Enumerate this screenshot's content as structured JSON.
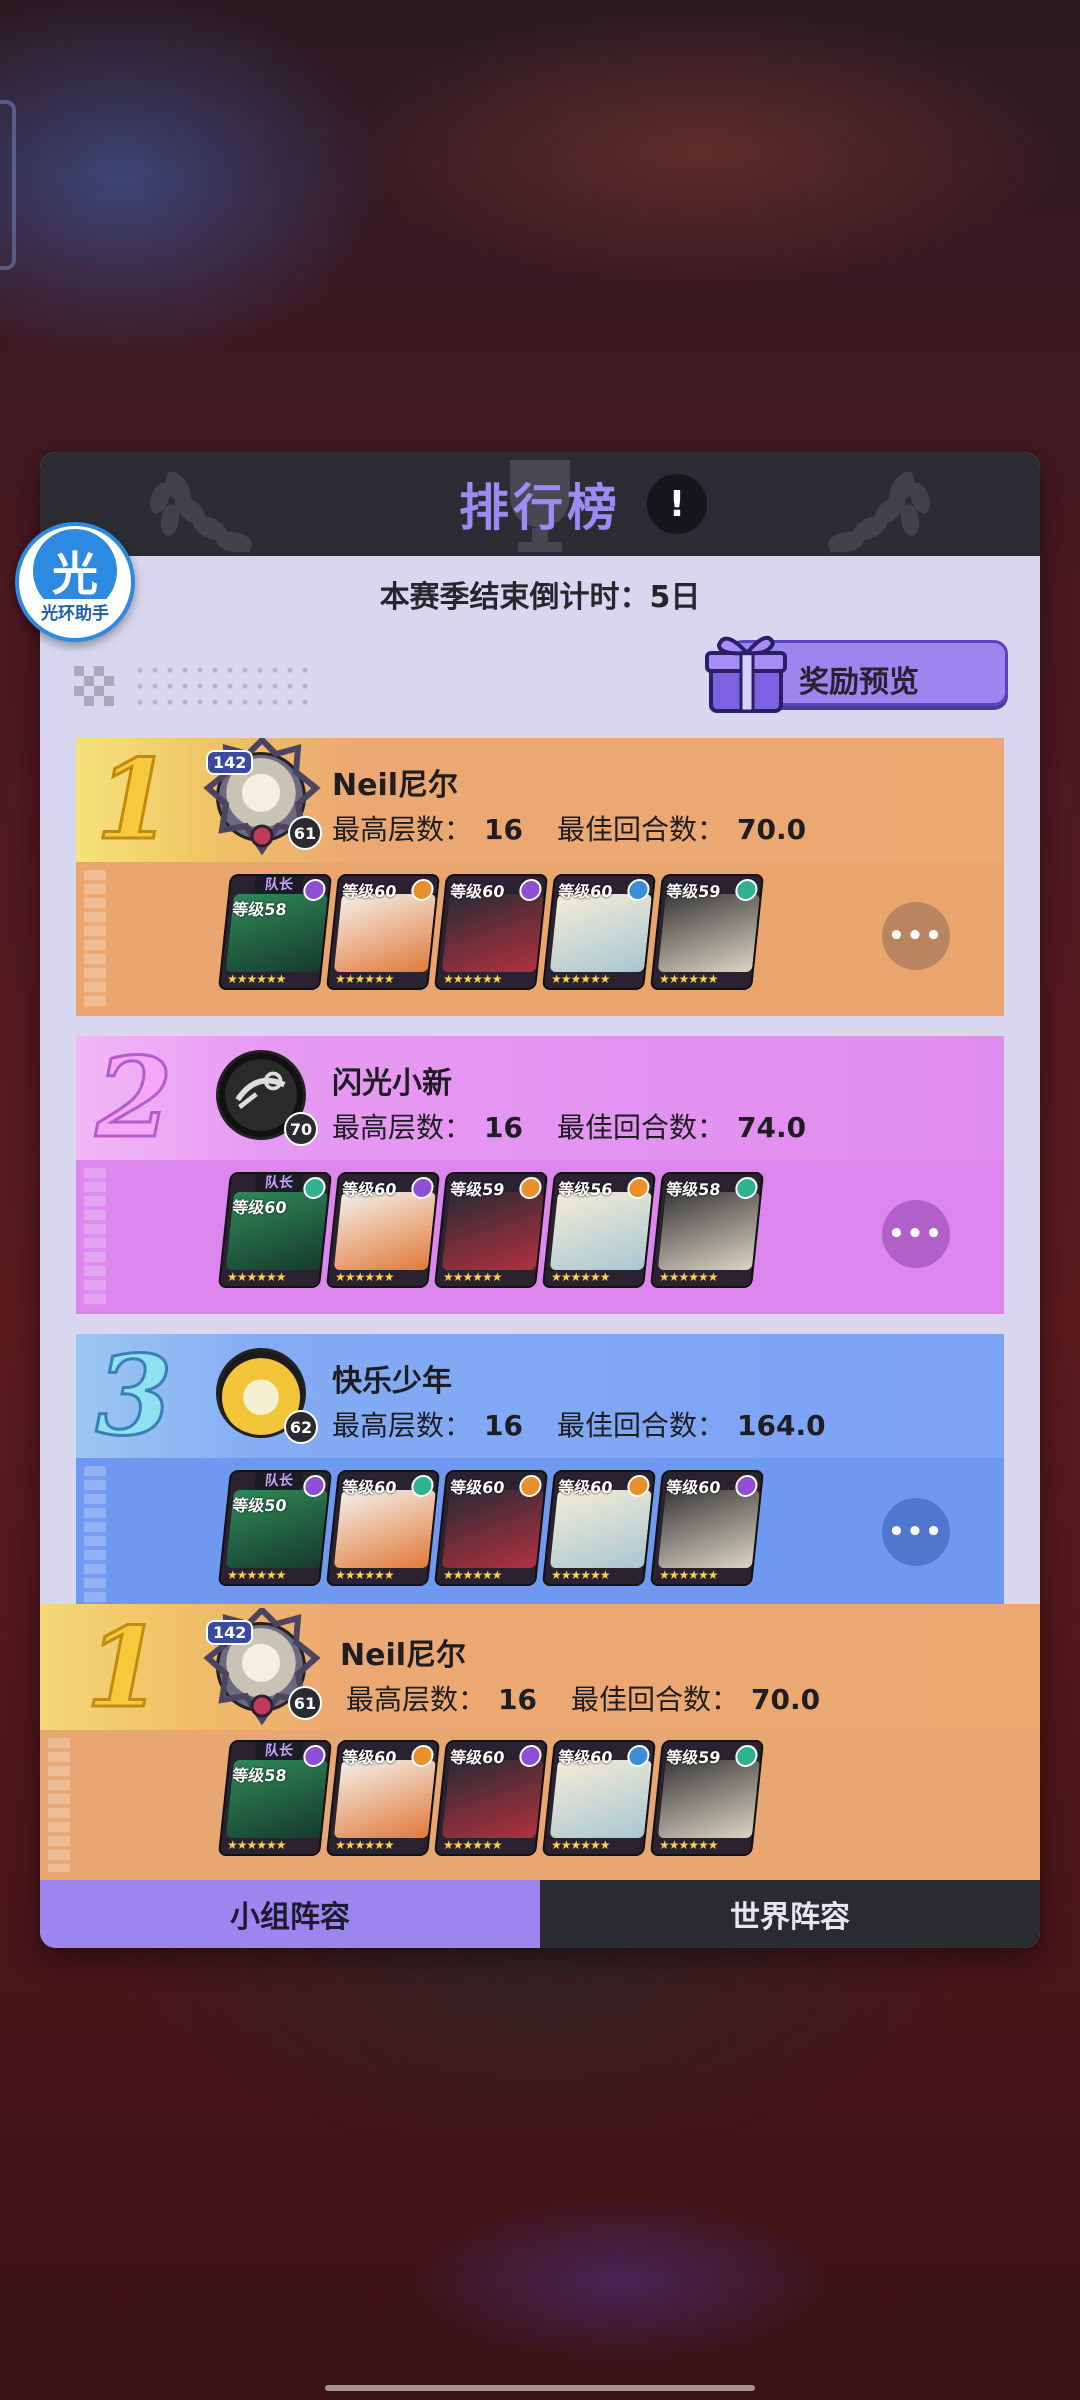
{
  "leaderboard": {
    "title": "排行榜",
    "info_label": "!",
    "countdown": "本赛季结束倒计时：5日",
    "reward_preview": "奖励预览",
    "stat_labels": {
      "max_floor": "最高层数：",
      "best_rounds": "最佳回合数："
    },
    "captain_label": "队长",
    "more_label": "•••",
    "entries": [
      {
        "rank": "1",
        "name": "Neil尼尔",
        "avatar_level": "61",
        "badge": "142",
        "max_floor": "16",
        "best_rounds": "70.0",
        "heroes": [
          {
            "level": "等级58",
            "captain": true,
            "element": "purple"
          },
          {
            "level": "等级60",
            "captain": false,
            "element": "orange"
          },
          {
            "level": "等级60",
            "captain": false,
            "element": "purple"
          },
          {
            "level": "等级60",
            "captain": false,
            "element": "blue"
          },
          {
            "level": "等级59",
            "captain": false,
            "element": "green"
          }
        ]
      },
      {
        "rank": "2",
        "name": "闪光小新",
        "avatar_level": "70",
        "badge": "",
        "max_floor": "16",
        "best_rounds": "74.0",
        "heroes": [
          {
            "level": "等级60",
            "captain": true,
            "element": "green"
          },
          {
            "level": "等级60",
            "captain": false,
            "element": "purple"
          },
          {
            "level": "等级59",
            "captain": false,
            "element": "orange"
          },
          {
            "level": "等级56",
            "captain": false,
            "element": "orange"
          },
          {
            "level": "等级58",
            "captain": false,
            "element": "green"
          }
        ]
      },
      {
        "rank": "3",
        "name": "快乐少年",
        "avatar_level": "62",
        "badge": "",
        "max_floor": "16",
        "best_rounds": "164.0",
        "heroes": [
          {
            "level": "等级50",
            "captain": true,
            "element": "purple"
          },
          {
            "level": "等级60",
            "captain": false,
            "element": "green"
          },
          {
            "level": "等级60",
            "captain": false,
            "element": "orange"
          },
          {
            "level": "等级60",
            "captain": false,
            "element": "orange"
          },
          {
            "level": "等级60",
            "captain": false,
            "element": "purple"
          }
        ]
      }
    ],
    "self": {
      "rank": "1",
      "name": "Neil尼尔",
      "avatar_level": "61",
      "badge": "142",
      "max_floor": "16",
      "best_rounds": "70.0",
      "heroes": [
        {
          "level": "等级58",
          "captain": true,
          "element": "purple"
        },
        {
          "level": "等级60",
          "captain": false,
          "element": "orange"
        },
        {
          "level": "等级60",
          "captain": false,
          "element": "purple"
        },
        {
          "level": "等级60",
          "captain": false,
          "element": "blue"
        },
        {
          "level": "等级59",
          "captain": false,
          "element": "green"
        }
      ]
    },
    "tabs": [
      {
        "label": "小组阵容",
        "active": true
      },
      {
        "label": "世界阵容",
        "active": false
      }
    ]
  },
  "assistant": {
    "glyph": "光",
    "caption": "光环助手"
  },
  "colors": {
    "accent": "#9b86f0",
    "rank1": "#eca873",
    "rank2": "#e28cf2",
    "rank3": "#7aa4f5"
  }
}
